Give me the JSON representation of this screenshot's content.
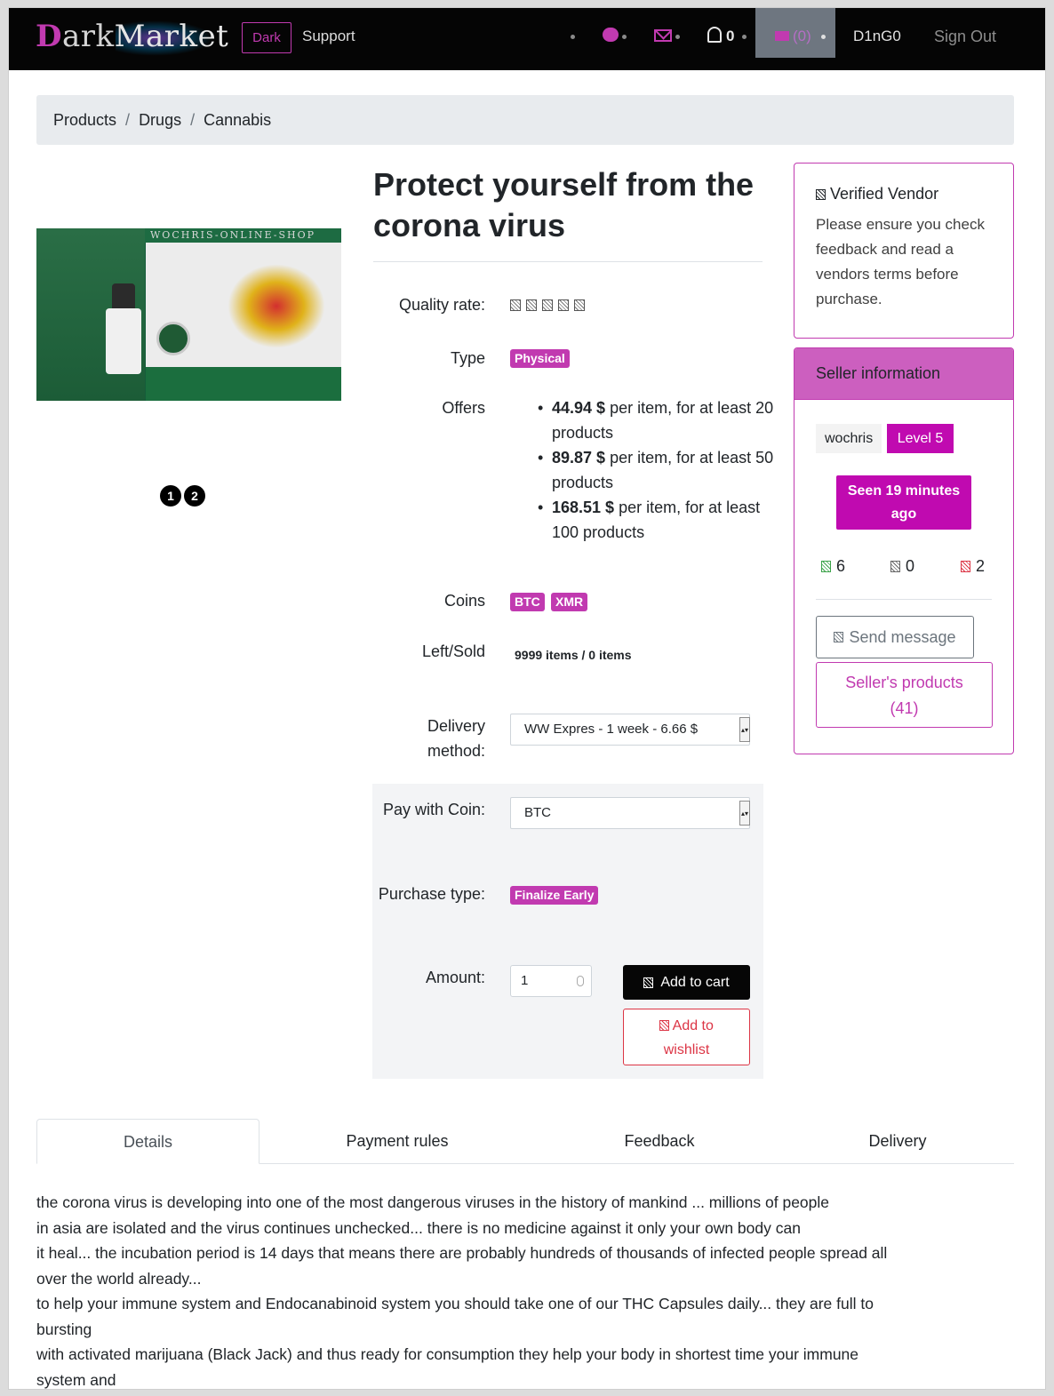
{
  "navbar": {
    "logo": {
      "d": "D",
      "ark": "ark",
      "market": "Market"
    },
    "theme_toggle": "Dark",
    "support": "Support",
    "notifications_count": "0",
    "cart_count": "(0)",
    "username": "D1nG0",
    "sign_out": "Sign Out",
    "accent_color": "#c13ab0"
  },
  "breadcrumb": [
    "Products",
    "Drugs",
    "Cannabis"
  ],
  "product": {
    "image_banner": "WOCHRIS-ONLINE-SHOP",
    "carousel": [
      "1",
      "2"
    ],
    "title": "Protect yourself from the corona virus",
    "labels": {
      "quality": "Quality rate:",
      "type": "Type",
      "offers": "Offers",
      "coins": "Coins",
      "left_sold": "Left/Sold",
      "delivery": "Delivery method:",
      "pay_with": "Pay with Coin:",
      "purchase_type": "Purchase type:",
      "amount": "Amount:"
    },
    "quality_stars": 5,
    "type": "Physical",
    "offers": [
      {
        "price": "44.94 $",
        "text": " per item, for at least 20 products"
      },
      {
        "price": "89.87 $",
        "text": " per item, for at least 50 products"
      },
      {
        "price": "168.51 $",
        "text": " per item, for at least 100 products"
      }
    ],
    "coins": [
      "BTC",
      "XMR"
    ],
    "left_sold": "9999 items / 0 items",
    "delivery_method": "WW Expres - 1 week - 6.66 $",
    "pay_coin": "BTC",
    "purchase_type": "Finalize Early",
    "amount": "1",
    "add_to_cart": "Add to cart",
    "add_to_wishlist_1": "Add to",
    "add_to_wishlist_2": "wishlist"
  },
  "vendor_notice": {
    "title": "Verified Vendor",
    "text": "Please ensure you check feedback and read a vendors terms before purchase."
  },
  "seller": {
    "header": "Seller information",
    "name": "wochris",
    "level": "Level 5",
    "seen_1": "Seen 19 minutes",
    "seen_2": "ago",
    "feedback_positive": "6",
    "feedback_neutral": "0",
    "feedback_negative": "2",
    "send_message": "Send message",
    "products_1": "Seller's products",
    "products_2": "(41)"
  },
  "tabs": [
    "Details",
    "Payment rules",
    "Feedback",
    "Delivery"
  ],
  "details_lines": [
    "the corona virus is developing into one of the most dangerous viruses in the history of mankind ... millions of people",
    "in asia are isolated and the virus continues unchecked... there is no medicine against it only your own body can",
    "it heal... the incubation period is 14 days that means there are probably hundreds of thousands of infected people spread all",
    "over the world already...",
    "to help your immune system and Endocanabinoid system you should take one of our THC Capsules daily... they are full to",
    "bursting",
    "with activated marijuana (Black Jack) and thus ready for consumption they help your body in shortest time your immune",
    "system and"
  ]
}
